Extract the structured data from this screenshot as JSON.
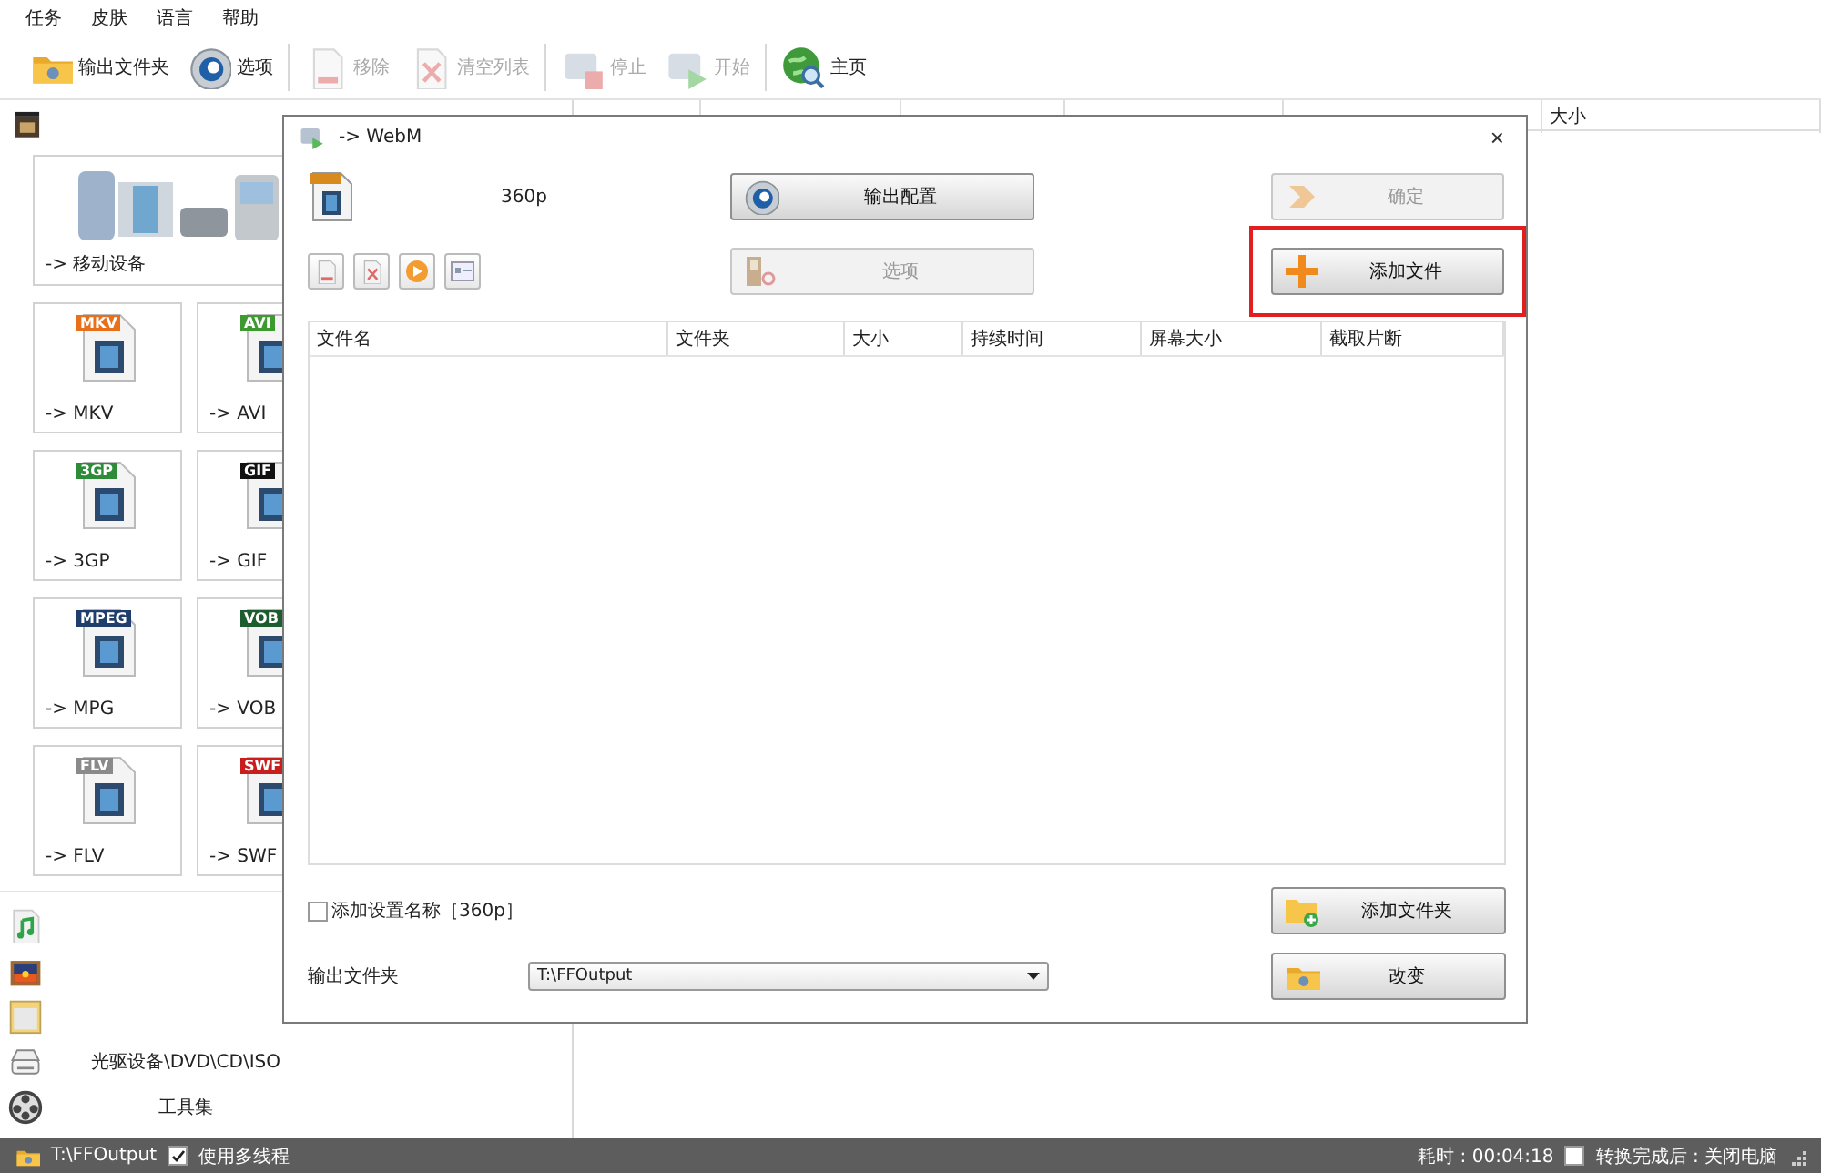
{
  "menu": [
    {
      "label": "任务"
    },
    {
      "label": "皮肤"
    },
    {
      "label": "语言"
    },
    {
      "label": "帮助"
    }
  ],
  "toolbar": [
    [
      {
        "label": "输出文件夹",
        "kind": "folder",
        "disabled": false
      },
      {
        "label": "选项",
        "kind": "gear",
        "disabled": false
      }
    ],
    [
      {
        "label": "移除",
        "kind": "remove",
        "disabled": true
      },
      {
        "label": "清空列表",
        "kind": "clear",
        "disabled": true
      }
    ],
    [
      {
        "label": "停止",
        "kind": "stop",
        "disabled": true
      },
      {
        "label": "开始",
        "kind": "start",
        "disabled": true
      }
    ],
    [
      {
        "label": "主页",
        "kind": "globe",
        "disabled": false
      }
    ]
  ],
  "sidebar": {
    "top_category": {
      "kind": "video"
    },
    "mobile_tile": {
      "label": "-> 移动设备"
    },
    "tiles": [
      {
        "label": "-> MKV",
        "badge": "MKV",
        "color": "#e8701a"
      },
      {
        "label": "-> AVI",
        "badge": "AVI",
        "color": "#3c9a2e"
      },
      {
        "label": "-> 3GP",
        "badge": "3GP",
        "color": "#2e8b3a"
      },
      {
        "label": "-> GIF",
        "badge": "GIF",
        "color": "#111111"
      },
      {
        "label": "-> MPG",
        "badge": "MPEG",
        "color": "#1f3e6b"
      },
      {
        "label": "-> VOB",
        "badge": "VOB",
        "color": "#1d5c2e"
      },
      {
        "label": "-> FLV",
        "badge": "FLV",
        "color": "#8a8a8a"
      },
      {
        "label": "-> SWF",
        "badge": "SWF",
        "color": "#c81e1e"
      }
    ],
    "categories": [
      {
        "kind": "music"
      },
      {
        "kind": "picture"
      },
      {
        "kind": "document"
      },
      {
        "kind": "disc",
        "label": "光驱设备\\DVD\\CD\\ISO"
      },
      {
        "kind": "tools",
        "label": "工具集"
      }
    ]
  },
  "queue_table": {
    "columns": [
      {
        "label": "大小"
      }
    ]
  },
  "dialog": {
    "title": "-> WebM",
    "close": "×",
    "preset": "360p",
    "output_config": {
      "label": "输出配置",
      "disabled": false
    },
    "options": {
      "label": "选项",
      "disabled": true
    },
    "ok": {
      "label": "确定",
      "disabled": true
    },
    "add_file": {
      "label": "添加文件",
      "disabled": false,
      "highlighted": true
    },
    "file_table": {
      "columns": [
        {
          "label": "文件名"
        },
        {
          "label": "文件夹"
        },
        {
          "label": "大小"
        },
        {
          "label": "持续时间"
        },
        {
          "label": "屏幕大小"
        },
        {
          "label": "截取片断"
        }
      ]
    },
    "add_name": {
      "label": "添加设置名称［360p］",
      "checked": false
    },
    "add_folder": {
      "label": "添加文件夹"
    },
    "output_folder": {
      "label": "输出文件夹",
      "value": "T:\\FFOutput"
    },
    "change": {
      "label": "改变"
    }
  },
  "status_bar": {
    "output_path": "T:\\FFOutput",
    "multithread": {
      "label": "使用多线程",
      "checked": true
    },
    "elapsed": "耗时 : 00:04:18",
    "shutdown": {
      "label": "转换完成后 : 关闭电脑",
      "checked": false
    }
  }
}
